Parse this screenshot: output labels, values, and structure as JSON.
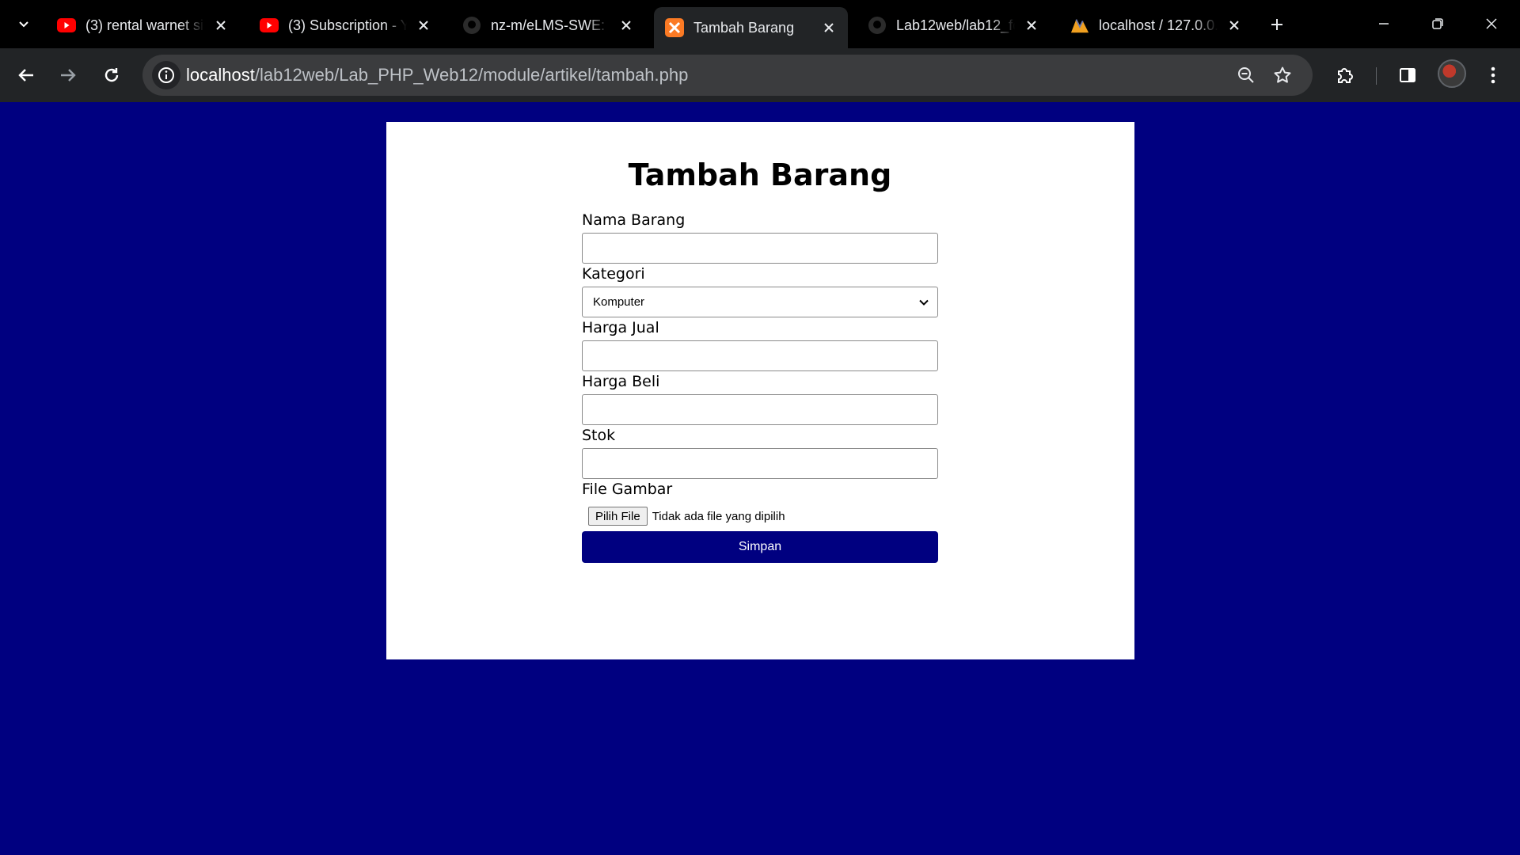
{
  "tabs": [
    {
      "title": "(3) rental warnet si",
      "favicon": "youtube-icon",
      "active": false
    },
    {
      "title": "(3) Subscription - Y",
      "favicon": "youtube-icon",
      "active": false
    },
    {
      "title": "nz-m/eLMS-SWE: c",
      "favicon": "github-icon",
      "active": false
    },
    {
      "title": "Tambah Barang",
      "favicon": "xampp-icon",
      "active": true
    },
    {
      "title": "Lab12web/lab12_fo",
      "favicon": "github-icon",
      "active": false
    },
    {
      "title": "localhost / 127.0.0.",
      "favicon": "phpmyadmin-icon",
      "active": false
    }
  ],
  "address_bar": {
    "host": "localhost",
    "path": "/lab12web/Lab_PHP_Web12/module/artikel/tambah.php"
  },
  "form": {
    "title": "Tambah Barang",
    "fields": {
      "nama_label": "Nama Barang",
      "nama_value": "",
      "kategori_label": "Kategori",
      "kategori_selected": "Komputer",
      "harga_jual_label": "Harga Jual",
      "harga_jual_value": "",
      "harga_beli_label": "Harga Beli",
      "harga_beli_value": "",
      "stok_label": "Stok",
      "stok_value": "",
      "gambar_label": "File Gambar",
      "file_button": "Pilih File",
      "file_status": "Tidak ada file yang dipilih"
    },
    "submit_label": "Simpan"
  },
  "colors": {
    "page_background": "#000080",
    "button_background": "#000080",
    "card_background": "#ffffff"
  }
}
